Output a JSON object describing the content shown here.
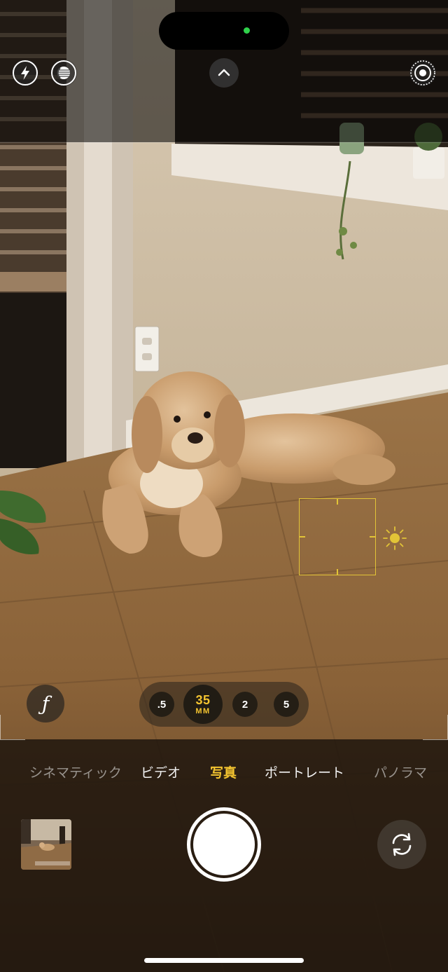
{
  "top_bar": {
    "flash_icon": "flash-icon",
    "live_photo_icon": "live-photo-icon",
    "expand_icon": "chevron-up-icon",
    "settings_icon": "live-rings-icon"
  },
  "zoom": {
    "options": [
      ".5",
      "2",
      "5"
    ],
    "active_value": "35",
    "active_unit": "MM"
  },
  "aperture_label": "ƒ",
  "modes": [
    {
      "label": "シネマティック",
      "active": false
    },
    {
      "label": "ビデオ",
      "active": false
    },
    {
      "label": "写真",
      "active": true
    },
    {
      "label": "ポートレート",
      "active": false
    },
    {
      "label": "パノラマ",
      "active": false
    }
  ],
  "colors": {
    "accent": "#f4c430",
    "focus": "#e2c437",
    "island_dot": "#2fd14b"
  }
}
